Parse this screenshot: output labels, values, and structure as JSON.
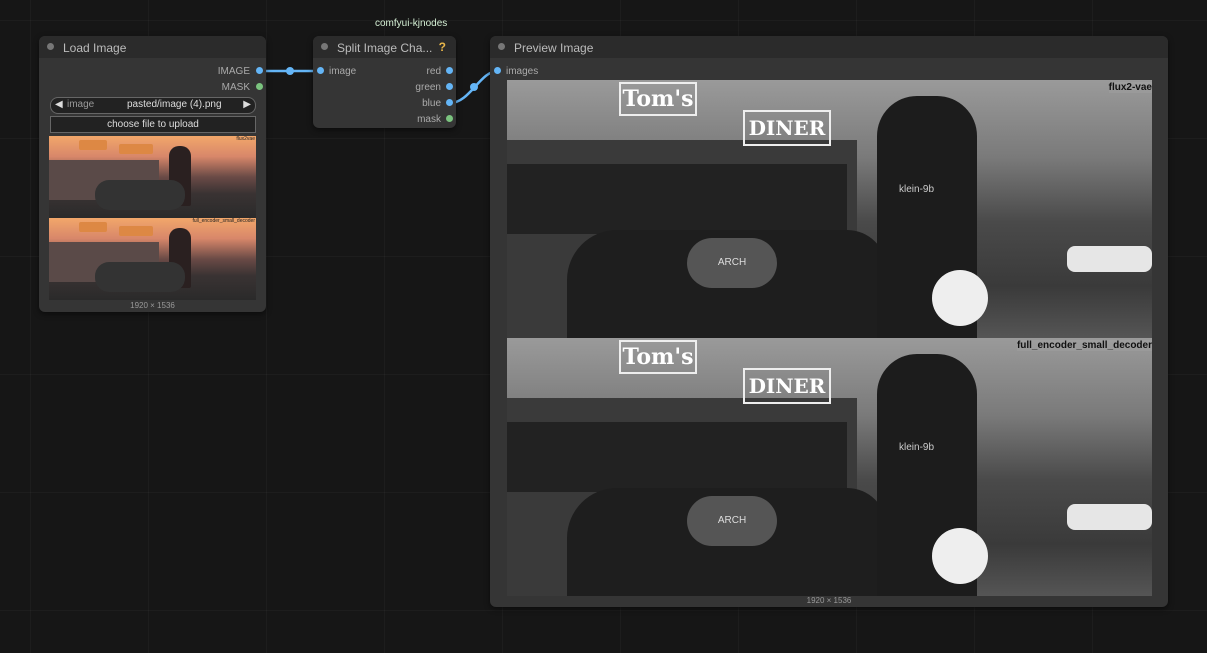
{
  "group_tag": "comfyui-kjnodes",
  "load_image": {
    "title": "Load Image",
    "outputs": [
      "IMAGE",
      "MASK"
    ],
    "combo_arrow_left": "◀",
    "combo_label": "image",
    "combo_value": "pasted/image (4).png",
    "combo_arrow_right": "▶",
    "upload_label": "choose file to upload",
    "thumb_top_tag": "flux2vae",
    "thumb_bottom_tag": "full_encoder_small_decoder",
    "size": "1920 × 1536"
  },
  "split_node": {
    "title": "Split Image Cha...",
    "help": "?",
    "input": "image",
    "outputs": [
      "red",
      "green",
      "blue",
      "mask"
    ]
  },
  "preview_image": {
    "title": "Preview Image",
    "input": "images",
    "top_label": "flux2-vae",
    "bottom_label": "full_encoder_small_decoder",
    "size": "1920 × 1536",
    "sign_toms": "Tom's",
    "sign_diner": "DINER",
    "tank_brand": "ARCH",
    "shirt_text": "klein-9b"
  },
  "colors": {
    "link": "#64b5f6",
    "node_bg": "#353535",
    "canvas": "#161616"
  }
}
